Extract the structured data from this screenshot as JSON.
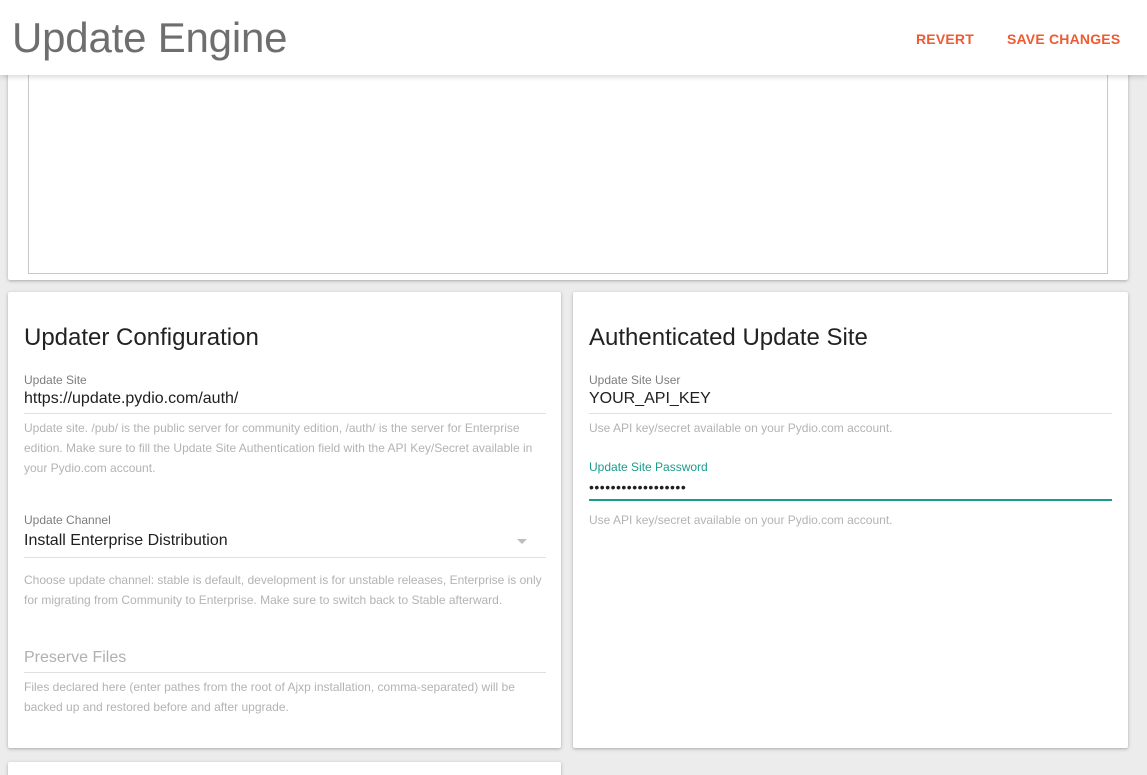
{
  "header": {
    "title": "Update Engine",
    "revert_label": "REVERT",
    "save_label": "SAVE CHANGES",
    "accent_color": "#ef5a32"
  },
  "updater_configuration": {
    "title": "Updater Configuration",
    "update_site": {
      "label": "Update Site",
      "value": "https://update.pydio.com/auth/",
      "help": "Update site. /pub/ is the public server for community edition, /auth/ is the server for Enterprise edition. Make sure to fill the Update Site Authentication field with the API Key/Secret available in your Pydio.com account."
    },
    "update_channel": {
      "label": "Update Channel",
      "value": "Install Enterprise Distribution",
      "help": "Choose update channel: stable is default, development is for unstable releases, Enterprise is only for migrating from Community to Enterprise. Make sure to switch back to Stable afterward.",
      "icon": "dropdown-arrow-icon"
    },
    "preserve_files": {
      "placeholder": "Preserve Files",
      "value": "",
      "help": "Files declared here (enter pathes from the root of Ajxp installation, comma-separated) will be backed up and restored before and after upgrade."
    }
  },
  "authenticated_update_site": {
    "title": "Authenticated Update Site",
    "user": {
      "label": "Update Site User",
      "value": "YOUR_API_KEY",
      "help": "Use API key/secret available on your Pydio.com account."
    },
    "password": {
      "label": "Update Site Password",
      "value": "••••••••••••••••••",
      "help": "Use API key/secret available on your Pydio.com account.",
      "focus_color": "#1a9c8d"
    }
  }
}
